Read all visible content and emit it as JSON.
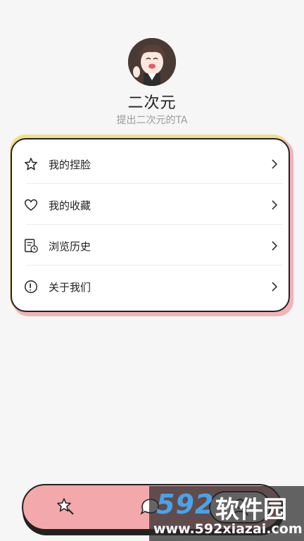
{
  "profile": {
    "name": "二次元",
    "subtitle": "提出二次元的TA"
  },
  "menu": {
    "items": [
      {
        "label": "我的捏脸",
        "icon": "star-icon"
      },
      {
        "label": "我的收藏",
        "icon": "heart-icon"
      },
      {
        "label": "浏览历史",
        "icon": "history-icon"
      },
      {
        "label": "关于我们",
        "icon": "info-icon"
      }
    ]
  },
  "tabbar": {
    "tabs": [
      {
        "icon": "star-wand-icon"
      },
      {
        "icon": "chat-bubble-icon"
      },
      {
        "icon": "profile-icon"
      }
    ]
  },
  "watermark": {
    "brand": "592",
    "brand_cn": "软件园",
    "url": "www.592xiazai.com"
  },
  "colors": {
    "background": "#f6f6f6",
    "card_accent_yellow": "#f3de8a",
    "card_accent_pink": "#f3b3b7",
    "tabbar": "#f3a9ab",
    "watermark_blue": "#4aa3e8"
  }
}
